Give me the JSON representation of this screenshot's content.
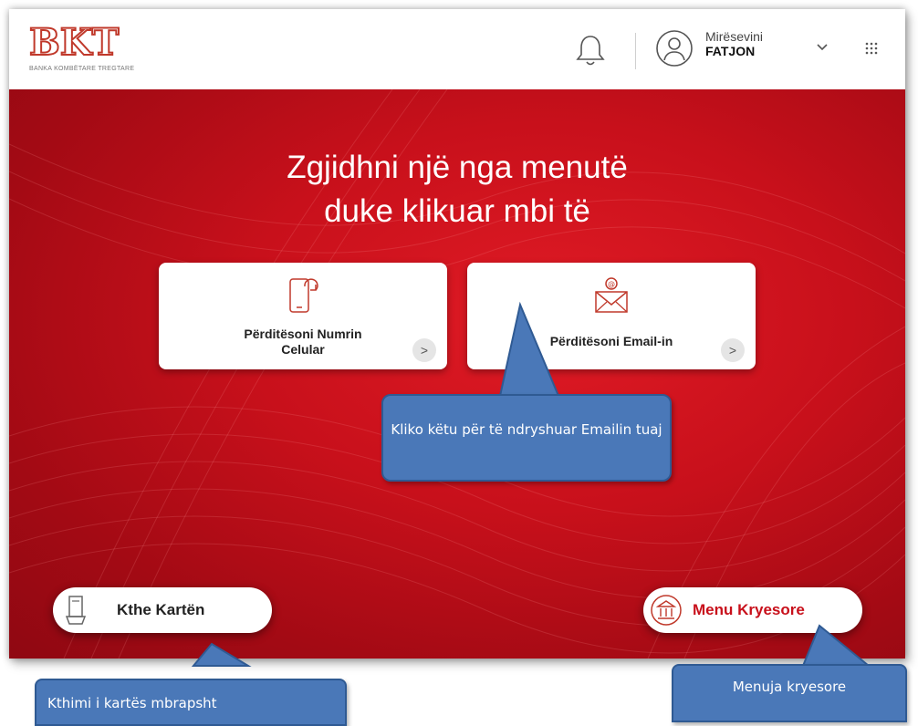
{
  "header": {
    "logo_mark": "BKT",
    "logo_subtitle": "BANKA KOMBËTARE TREGTARE",
    "greeting": "Mirësevini",
    "user_name": "FATJON"
  },
  "main": {
    "headline_line1": "Zgjidhni një nga menutë",
    "headline_line2": "duke klikuar mbi të",
    "cards": [
      {
        "label_line1": "Përditësoni Numrin",
        "label_line2": "Celular",
        "icon": "phone-refresh-icon",
        "arrow": ">"
      },
      {
        "label_line1": "Përditësoni Email-in",
        "label_line2": "",
        "icon": "email-refresh-icon",
        "arrow": ">"
      }
    ],
    "return_card_button": "Kthe Kartën",
    "main_menu_button": "Menu Kryesore"
  },
  "callouts": {
    "email_hint": "Kliko këtu për të ndryshuar Emailin tuaj",
    "return_card_hint": "Kthimi i kartës mbrapsht",
    "main_menu_hint": "Menuja kryesore"
  },
  "colors": {
    "brand_red": "#d0121d",
    "callout_blue": "#4a78b8",
    "callout_border": "#2f5a93"
  }
}
